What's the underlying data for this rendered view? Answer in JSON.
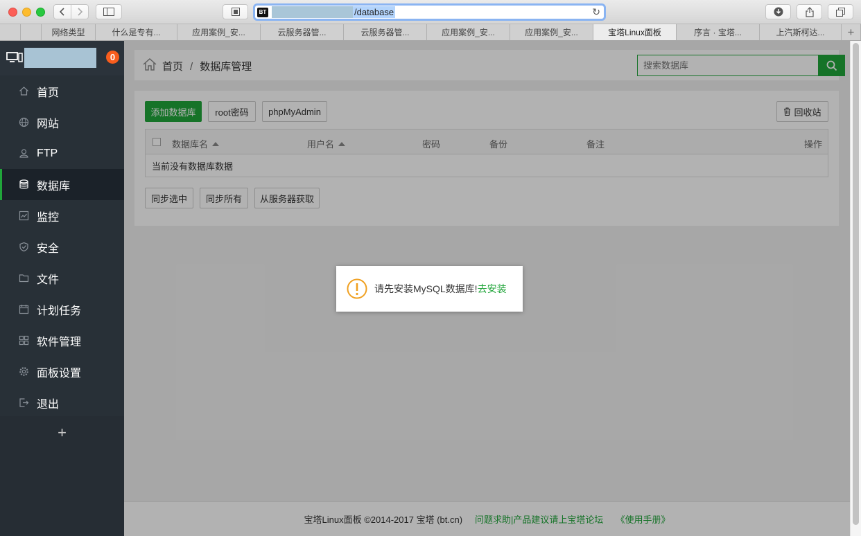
{
  "browser": {
    "url_path": "/database",
    "site_icon_label": "BT",
    "tabs": [
      {
        "label": "网络类型",
        "active": false
      },
      {
        "label": "什么是专有...",
        "active": false
      },
      {
        "label": "应用案例_安...",
        "active": false
      },
      {
        "label": "云服务器管...",
        "active": false
      },
      {
        "label": "云服务器管...",
        "active": false
      },
      {
        "label": "应用案例_安...",
        "active": false
      },
      {
        "label": "应用案例_安...",
        "active": false
      },
      {
        "label": "宝塔Linux面板",
        "active": true
      },
      {
        "label": "序言 · 宝塔...",
        "active": false
      },
      {
        "label": "上汽斯柯达...",
        "active": false
      }
    ],
    "new_tab_label": "+"
  },
  "sidebar": {
    "badge_count": "0",
    "items": [
      {
        "label": "首页",
        "icon": "home-icon",
        "active": false
      },
      {
        "label": "网站",
        "icon": "globe-icon",
        "active": false
      },
      {
        "label": "FTP",
        "icon": "ftp-icon",
        "active": false
      },
      {
        "label": "数据库",
        "icon": "database-icon",
        "active": true
      },
      {
        "label": "监控",
        "icon": "monitor-chart-icon",
        "active": false
      },
      {
        "label": "安全",
        "icon": "shield-icon",
        "active": false
      },
      {
        "label": "文件",
        "icon": "folder-icon",
        "active": false
      },
      {
        "label": "计划任务",
        "icon": "calendar-icon",
        "active": false
      },
      {
        "label": "软件管理",
        "icon": "apps-grid-icon",
        "active": false
      },
      {
        "label": "面板设置",
        "icon": "gear-icon",
        "active": false
      },
      {
        "label": "退出",
        "icon": "logout-icon",
        "active": false
      }
    ],
    "add_label": "+"
  },
  "header": {
    "crumb_home": "首页",
    "crumb_sep": "/",
    "crumb_current": "数据库管理",
    "search_placeholder": "搜索数据库"
  },
  "toolbar": {
    "add_db": "添加数据库",
    "root_pwd": "root密码",
    "phpmyadmin": "phpMyAdmin",
    "recycle": "回收站"
  },
  "table": {
    "columns": [
      "数据库名",
      "用户名",
      "密码",
      "备份",
      "备注",
      "操作"
    ],
    "empty_text": "当前没有数据库数据"
  },
  "actions": {
    "sync_selected": "同步选中",
    "sync_all": "同步所有",
    "fetch_server": "从服务器获取"
  },
  "footer": {
    "copyright": "宝塔Linux面板 ©2014-2017 宝塔 (bt.cn)",
    "forum_link": "问题求助|产品建议请上宝塔论坛",
    "manual_link": "《使用手册》"
  },
  "dialog": {
    "message": "请先安装MySQL数据库!",
    "link": "去安装"
  },
  "colors": {
    "accent": "#20a53a",
    "sidebar_bg": "#283037",
    "badge": "#f85d1d",
    "dialog_icon": "#f0a020"
  }
}
